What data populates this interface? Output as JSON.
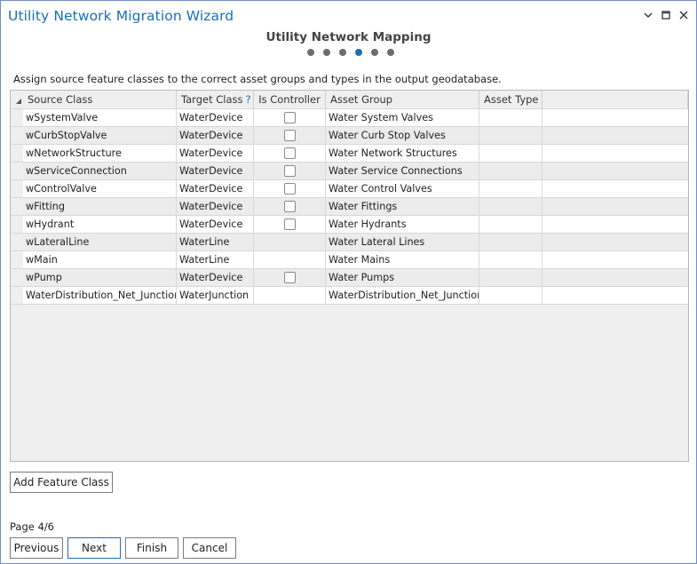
{
  "window": {
    "title": "Utility Network Migration Wizard",
    "controls": {
      "minimize": "minimize",
      "maximize": "maximize",
      "close": "close"
    }
  },
  "step": {
    "title": "Utility Network Mapping",
    "current": 4,
    "total": 6
  },
  "instructions": "Assign source feature classes to the correct asset groups and types in the output geodatabase.",
  "grid": {
    "columns": {
      "source_class": "Source Class",
      "target_class": "Target Class",
      "target_help": "?",
      "is_controller": "Is Controller",
      "asset_group": "Asset Group",
      "asset_type": "Asset Type"
    },
    "rows": [
      {
        "source": "wSystemValve",
        "target": "WaterDevice",
        "controller": true,
        "group": "Water System Valves",
        "type": ""
      },
      {
        "source": "wCurbStopValve",
        "target": "WaterDevice",
        "controller": true,
        "group": "Water Curb Stop Valves",
        "type": ""
      },
      {
        "source": "wNetworkStructure",
        "target": "WaterDevice",
        "controller": true,
        "group": "Water Network Structures",
        "type": ""
      },
      {
        "source": "wServiceConnection",
        "target": "WaterDevice",
        "controller": true,
        "group": "Water Service Connections",
        "type": ""
      },
      {
        "source": "wControlValve",
        "target": "WaterDevice",
        "controller": true,
        "group": "Water Control Valves",
        "type": ""
      },
      {
        "source": "wFitting",
        "target": "WaterDevice",
        "controller": true,
        "group": "Water Fittings",
        "type": ""
      },
      {
        "source": "wHydrant",
        "target": "WaterDevice",
        "controller": true,
        "group": "Water Hydrants",
        "type": ""
      },
      {
        "source": "wLateralLine",
        "target": "WaterLine",
        "controller": false,
        "group": "Water Lateral Lines",
        "type": ""
      },
      {
        "source": "wMain",
        "target": "WaterLine",
        "controller": false,
        "group": "Water Mains",
        "type": ""
      },
      {
        "source": "wPump",
        "target": "WaterDevice",
        "controller": true,
        "group": "Water Pumps",
        "type": ""
      },
      {
        "source": "WaterDistribution_Net_Junctions",
        "target": "WaterJunction",
        "controller": false,
        "group": "WaterDistribution_Net_Junctions",
        "type": ""
      }
    ]
  },
  "buttons": {
    "add_feature_class": "Add Feature Class",
    "previous": "Previous",
    "next": "Next",
    "finish": "Finish",
    "cancel": "Cancel"
  },
  "page_label": "Page 4/6",
  "colors": {
    "accent": "#1a6fb5",
    "border": "#6e8fbf"
  }
}
